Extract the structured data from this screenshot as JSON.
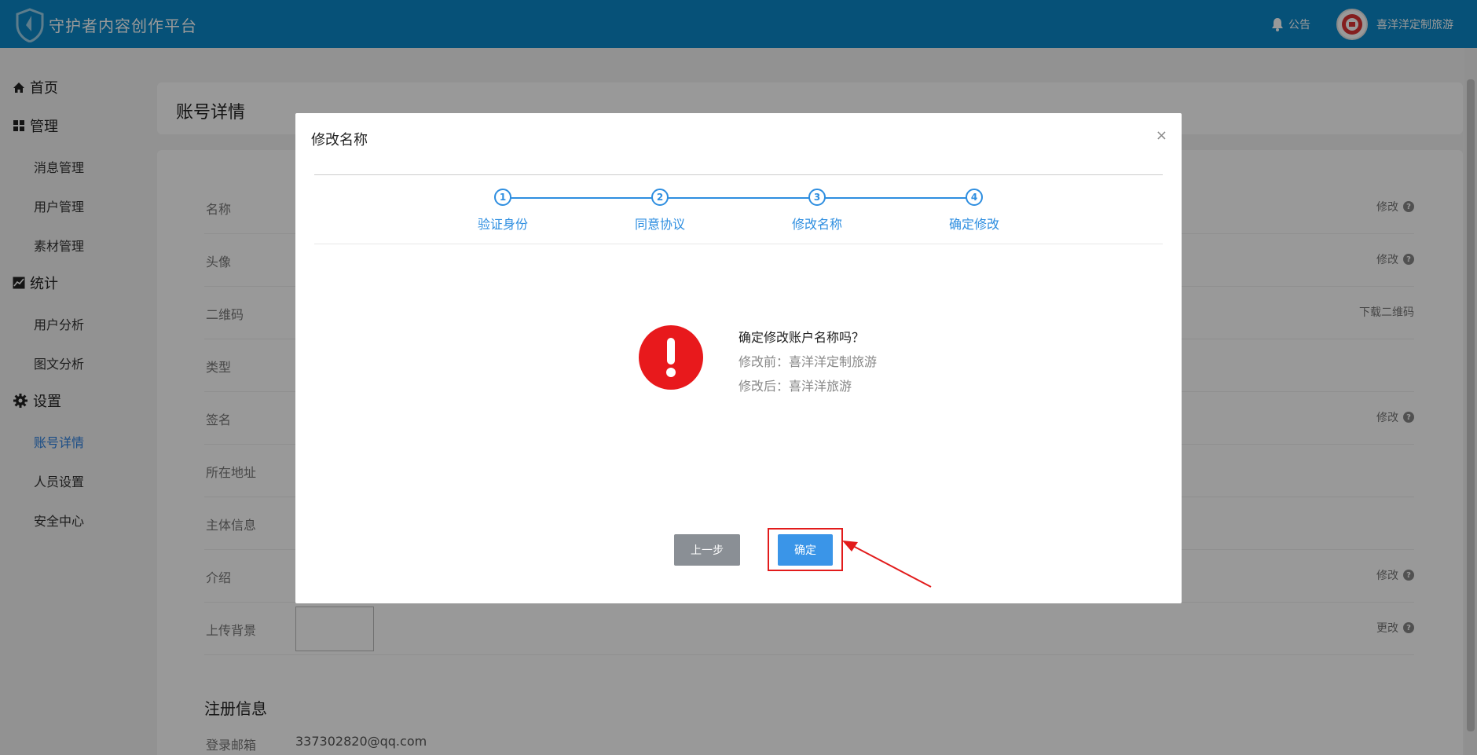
{
  "header": {
    "brand": "守护者内容创作平台",
    "notice_label": "公告",
    "username": "喜洋洋定制旅游"
  },
  "sidebar": {
    "home": "首页",
    "manage": "管理",
    "manage_items": [
      "消息管理",
      "用户管理",
      "素材管理"
    ],
    "stats": "统计",
    "stats_items": [
      "用户分析",
      "图文分析"
    ],
    "settings": "设置",
    "settings_items": [
      "账号详情",
      "人员设置",
      "安全中心"
    ]
  },
  "page": {
    "title": "账号详情",
    "rows": [
      {
        "label": "名称",
        "action": "修改"
      },
      {
        "label": "头像",
        "action": "修改"
      },
      {
        "label": "二维码",
        "action": "下载二维码"
      },
      {
        "label": "类型",
        "action": ""
      },
      {
        "label": "签名",
        "action": "修改"
      },
      {
        "label": "所在地址",
        "action": ""
      },
      {
        "label": "主体信息",
        "action": ""
      },
      {
        "label": "介绍",
        "action": "修改"
      },
      {
        "label": "上传背景",
        "action": "更改"
      }
    ],
    "register_section": "注册信息",
    "email_label": "登录邮箱",
    "email_value": "337302820@qq.com"
  },
  "modal": {
    "title": "修改名称",
    "close": "×",
    "steps": [
      {
        "num": "1",
        "label": "验证身份"
      },
      {
        "num": "2",
        "label": "同意协议"
      },
      {
        "num": "3",
        "label": "修改名称"
      },
      {
        "num": "4",
        "label": "确定修改"
      }
    ],
    "confirm_question": "确定修改账户名称吗？",
    "before": "修改前：喜洋洋定制旅游",
    "after": "修改后：喜洋洋旅游",
    "prev_label": "上一步",
    "ok_label": "确定"
  },
  "colors": {
    "header": "#0a88c9",
    "accent": "#2e8ee0",
    "warning": "#e8191c",
    "highlight": "#e21b1b"
  }
}
